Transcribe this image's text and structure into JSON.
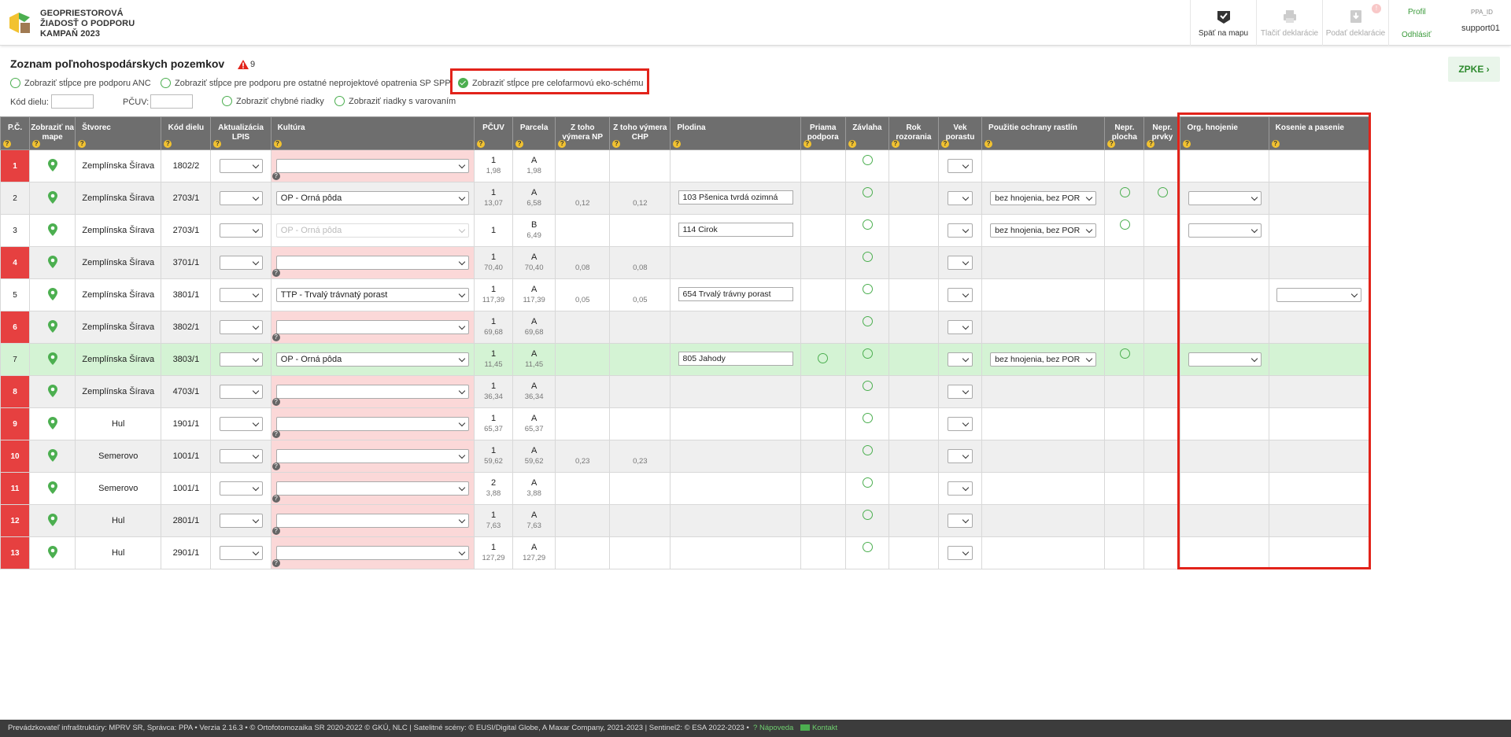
{
  "header": {
    "title_lines": [
      "GEOPRIESTOROVÁ",
      "ŽIADOSŤ O PODPORU",
      "KAMPAŇ 2023"
    ],
    "back_to_map": "Späť na mapu",
    "print_declaration": "Tlačiť deklarácie",
    "submit_declaration": "Podať deklarácie",
    "submit_badge": "!",
    "profile": "Profil",
    "logout": "Odhlásiť",
    "ppa_id_label": "PPA_ID",
    "ppa_id_value": "support01"
  },
  "page": {
    "title": "Zoznam poľnohospodárskych pozemkov",
    "warning_count": "9",
    "zpke_button": "ZPKE"
  },
  "filters": {
    "show_anc": "Zobraziť stĺpce pre podporu ANC",
    "show_sp": "Zobraziť stĺpce pre podporu pre ostatné neprojektové opatrenia SP SPP",
    "show_eko": "Zobraziť stĺpce pre celofarmovú eko-schému",
    "kod_label": "Kód dielu:",
    "pcuv_label": "PČUV:",
    "kod_value": "",
    "pcuv_value": "",
    "show_errors": "Zobraziť chybné riadky",
    "show_warnings": "Zobraziť riadky s varovaním"
  },
  "columns": [
    "P.Č.",
    "Zobraziť na mape",
    "Štvorec",
    "Kód dielu",
    "Aktualizácia LPIS",
    "Kultúra",
    "PČUV",
    "Parcela",
    "Z toho výmera NP",
    "Z toho výmera CHP",
    "Plodina",
    "Priama podpora",
    "Závlaha",
    "Rok rozorania",
    "Vek porastu",
    "Použitie ochrany rastlín",
    "Nepr. plocha",
    "Nepr. prvky",
    "Org. hnojenie",
    "Kosenie a pasenie"
  ],
  "rows": [
    {
      "pc": "1",
      "err": true,
      "stvorec": "Zemplínska Šírava",
      "kod": "1802/2",
      "kultura": "",
      "kult_err": true,
      "pcuv": "1",
      "pcuv_area": "1,98",
      "parcela": "A",
      "parcela_area": "1,98",
      "np": "",
      "chp": "",
      "plodina": "",
      "priama": false,
      "ochrana": "",
      "nepr_plocha": false,
      "nepr_prvky": false,
      "org": false,
      "kos": false,
      "style": "odd"
    },
    {
      "pc": "2",
      "err": false,
      "stvorec": "Zemplínska Šírava",
      "kod": "2703/1",
      "kultura": "OP - Orná pôda",
      "kult_err": false,
      "pcuv": "1",
      "pcuv_area": "13,07",
      "parcela": "A",
      "parcela_area": "6,58",
      "np": "0,12",
      "chp": "0,12",
      "plodina": "103  Pšenica tvrdá ozimná",
      "priama": false,
      "ochrana": "bez hnojenia, bez POR",
      "nepr_plocha": true,
      "nepr_prvky": true,
      "org": true,
      "kos": false,
      "style": "even"
    },
    {
      "pc": "3",
      "err": false,
      "stvorec": "Zemplínska Šírava",
      "kod": "2703/1",
      "kultura": "OP - Orná pôda",
      "kult_dis": true,
      "kult_err": false,
      "pcuv": "1",
      "pcuv_area": "",
      "parcela": "B",
      "parcela_area": "6,49",
      "np": "",
      "chp": "",
      "plodina": "114  Cirok",
      "priama": false,
      "ochrana": "bez hnojenia, bez POR",
      "nepr_plocha": true,
      "nepr_prvky": false,
      "org": true,
      "kos": false,
      "style": "odd"
    },
    {
      "pc": "4",
      "err": true,
      "stvorec": "Zemplínska Šírava",
      "kod": "3701/1",
      "kultura": "",
      "kult_err": true,
      "pcuv": "1",
      "pcuv_area": "70,40",
      "parcela": "A",
      "parcela_area": "70,40",
      "np": "0,08",
      "chp": "0,08",
      "plodina": "",
      "priama": false,
      "ochrana": "",
      "nepr_plocha": false,
      "nepr_prvky": false,
      "org": false,
      "kos": false,
      "style": "even"
    },
    {
      "pc": "5",
      "err": false,
      "stvorec": "Zemplínska Šírava",
      "kod": "3801/1",
      "kultura": "TTP - Trvalý trávnatý porast",
      "kult_err": false,
      "pcuv": "1",
      "pcuv_area": "117,39",
      "parcela": "A",
      "parcela_area": "117,39",
      "np": "0,05",
      "chp": "0,05",
      "plodina": "654  Trvalý trávny porast",
      "priama": false,
      "ochrana": "",
      "nepr_plocha": false,
      "nepr_prvky": false,
      "org": false,
      "kos": true,
      "style": "odd"
    },
    {
      "pc": "6",
      "err": true,
      "stvorec": "Zemplínska Šírava",
      "kod": "3802/1",
      "kultura": "",
      "kult_err": true,
      "pcuv": "1",
      "pcuv_area": "69,68",
      "parcela": "A",
      "parcela_area": "69,68",
      "np": "",
      "chp": "",
      "plodina": "",
      "priama": false,
      "ochrana": "",
      "nepr_plocha": false,
      "nepr_prvky": false,
      "org": false,
      "kos": false,
      "style": "even"
    },
    {
      "pc": "7",
      "err": false,
      "stvorec": "Zemplínska Šírava",
      "kod": "3803/1",
      "kultura": "OP - Orná pôda",
      "kult_err": false,
      "pcuv": "1",
      "pcuv_area": "11,45",
      "parcela": "A",
      "parcela_area": "11,45",
      "np": "",
      "chp": "",
      "plodina": "805  Jahody",
      "priama": true,
      "ochrana": "bez hnojenia, bez POR",
      "nepr_plocha": true,
      "nepr_prvky": false,
      "org": true,
      "kos": false,
      "style": "green"
    },
    {
      "pc": "8",
      "err": true,
      "stvorec": "Zemplínska Šírava",
      "kod": "4703/1",
      "kultura": "",
      "kult_err": true,
      "pcuv": "1",
      "pcuv_area": "36,34",
      "parcela": "A",
      "parcela_area": "36,34",
      "np": "",
      "chp": "",
      "plodina": "",
      "priama": false,
      "ochrana": "",
      "nepr_plocha": false,
      "nepr_prvky": false,
      "org": false,
      "kos": false,
      "style": "even"
    },
    {
      "pc": "9",
      "err": true,
      "stvorec": "Hul",
      "kod": "1901/1",
      "kultura": "",
      "kult_err": true,
      "pcuv": "1",
      "pcuv_area": "65,37",
      "parcela": "A",
      "parcela_area": "65,37",
      "np": "",
      "chp": "",
      "plodina": "",
      "priama": false,
      "ochrana": "",
      "nepr_plocha": false,
      "nepr_prvky": false,
      "org": false,
      "kos": false,
      "style": "odd"
    },
    {
      "pc": "10",
      "err": true,
      "stvorec": "Semerovo",
      "kod": "1001/1",
      "kultura": "",
      "kult_err": true,
      "pcuv": "1",
      "pcuv_area": "59,62",
      "parcela": "A",
      "parcela_area": "59,62",
      "np": "0,23",
      "chp": "0,23",
      "plodina": "",
      "priama": false,
      "ochrana": "",
      "nepr_plocha": false,
      "nepr_prvky": false,
      "org": false,
      "kos": false,
      "style": "even"
    },
    {
      "pc": "11",
      "err": true,
      "stvorec": "Semerovo",
      "kod": "1001/1",
      "kultura": "",
      "kult_err": true,
      "pcuv": "2",
      "pcuv_area": "3,88",
      "parcela": "A",
      "parcela_area": "3,88",
      "np": "",
      "chp": "",
      "plodina": "",
      "priama": false,
      "ochrana": "",
      "nepr_plocha": false,
      "nepr_prvky": false,
      "org": false,
      "kos": false,
      "style": "odd"
    },
    {
      "pc": "12",
      "err": true,
      "stvorec": "Hul",
      "kod": "2801/1",
      "kultura": "",
      "kult_err": true,
      "pcuv": "1",
      "pcuv_area": "7,63",
      "parcela": "A",
      "parcela_area": "7,63",
      "np": "",
      "chp": "",
      "plodina": "",
      "priama": false,
      "ochrana": "",
      "nepr_plocha": false,
      "nepr_prvky": false,
      "org": false,
      "kos": false,
      "style": "even"
    },
    {
      "pc": "13",
      "err": true,
      "stvorec": "Hul",
      "kod": "2901/1",
      "kultura": "",
      "kult_err": true,
      "pcuv": "1",
      "pcuv_area": "127,29",
      "parcela": "A",
      "parcela_area": "127,29",
      "np": "",
      "chp": "",
      "plodina": "",
      "priama": false,
      "ochrana": "",
      "nepr_plocha": false,
      "nepr_prvky": false,
      "org": false,
      "kos": false,
      "style": "odd"
    }
  ],
  "footer": {
    "text": "Prevádzkovateľ infraštruktúry: MPRV SR, Správca: PPA • Verzia 2.16.3 • © Ortofotomozaika SR 2020-2022 © GKÚ, NLC | Satelitné scény: © EUSI/Digital Globe, A Maxar Company, 2021-2023 | Sentinel2: © ESA 2022-2023 •",
    "help": "Nápoveda",
    "contact": "Kontakt"
  },
  "colors": {
    "accent_green": "#4caf50",
    "error_red": "#e64040",
    "highlight_red": "#e2231a",
    "header_gray": "#6e6e6e"
  }
}
